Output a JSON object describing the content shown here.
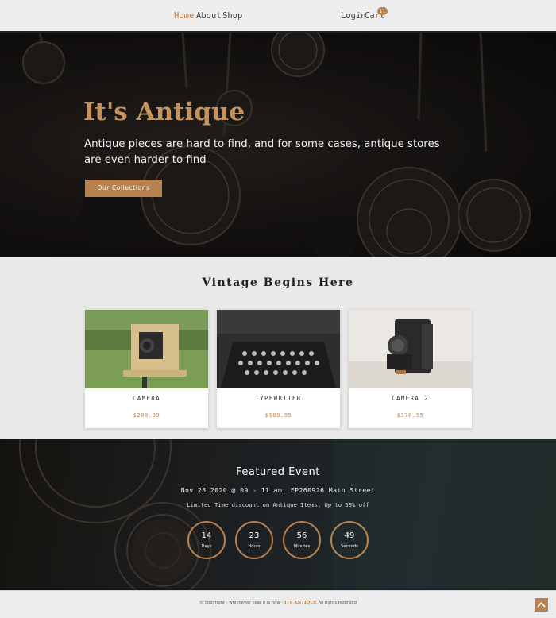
{
  "nav": {
    "items": [
      "Home",
      "About",
      "Shop"
    ],
    "login": "Login",
    "cart": "Cart",
    "cart_count": "11"
  },
  "hero": {
    "title": "It's Antique",
    "subtitle": "Antique pieces are hard to find, and for some cases, antique stores are even harder to find",
    "button": "Our Collections"
  },
  "products": {
    "title": "Vintage Begins Here",
    "items": [
      {
        "name": "CAMERA",
        "price": "$200.99"
      },
      {
        "name": "TYPEWRITER",
        "price": "$180.99"
      },
      {
        "name": "CAMERA 2",
        "price": "$370.95"
      }
    ]
  },
  "event": {
    "title": "Featured Event",
    "date": "Nov 28 2020 @ 09 - 11 am. EP260926 Main Street",
    "description": "Limited Time discount on Antique Items. Up to 50% off",
    "countdown": [
      {
        "value": "14",
        "label": "Days"
      },
      {
        "value": "23",
        "label": "Hours"
      },
      {
        "value": "56",
        "label": "Minutes"
      },
      {
        "value": "49",
        "label": "Seconds"
      }
    ]
  },
  "footer": {
    "copyright": "© copyright - whichever year it is now -",
    "brand": "ITS ANTIQUE",
    "rights": "All rights reserved"
  },
  "colors": {
    "accent": "#b7824f",
    "nav_bg": "#eeeeee",
    "page_bg": "#e9e9e9"
  },
  "icons": [
    "back-to-top-icon"
  ]
}
